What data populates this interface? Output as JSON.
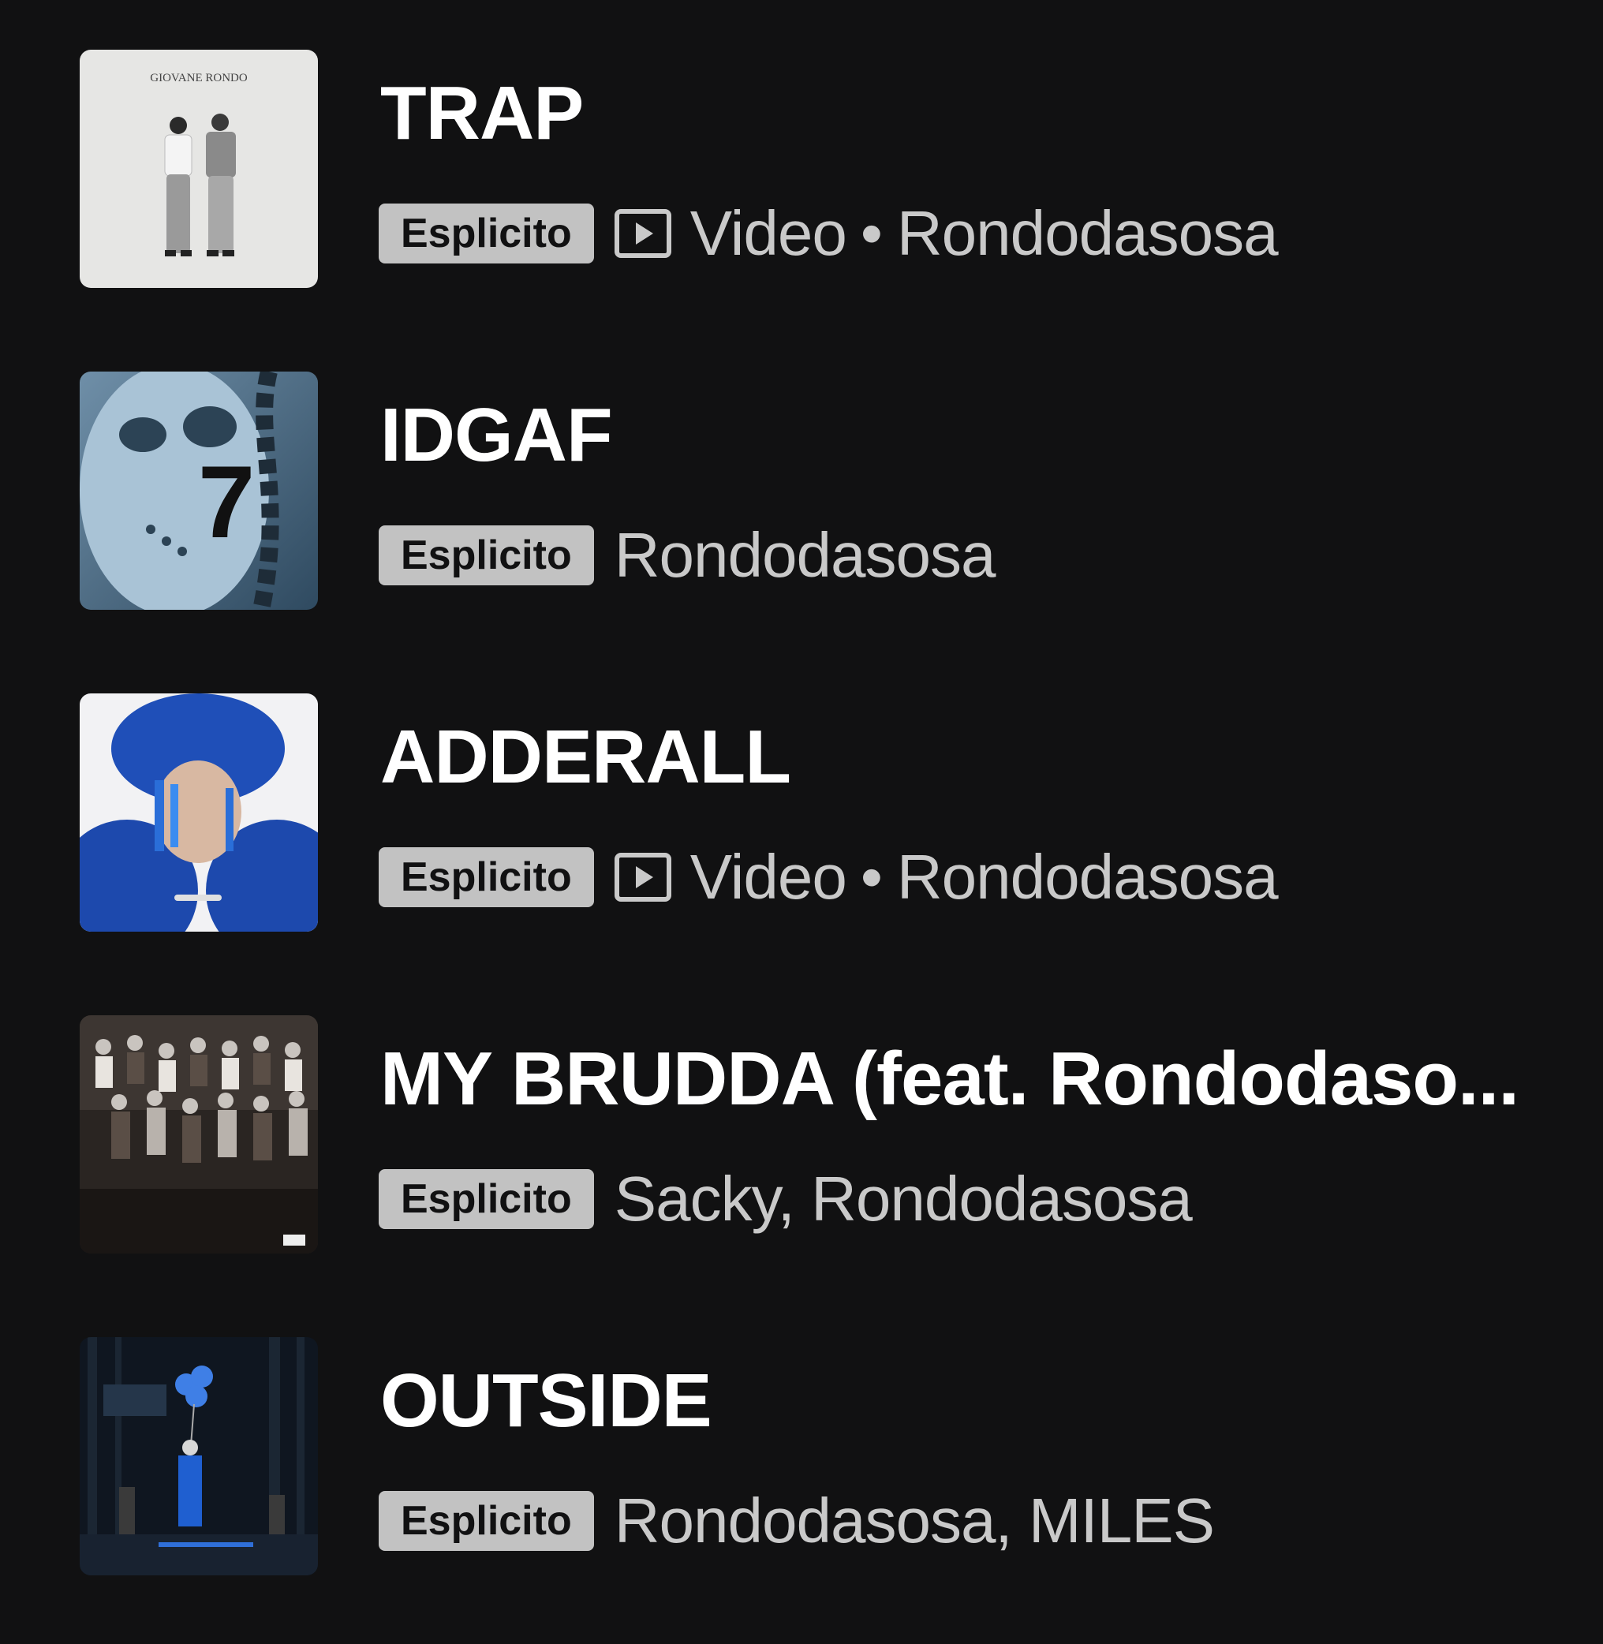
{
  "tracks": [
    {
      "title": "TRAP",
      "badge": "Esplicito",
      "has_video": true,
      "video_label": "Video",
      "separator": "•",
      "artists": "Rondodasosa",
      "art_text": "GIOVANE RONDO"
    },
    {
      "title": "IDGAF",
      "badge": "Esplicito",
      "has_video": false,
      "artists": "Rondodasosa",
      "art_text": "7"
    },
    {
      "title": "ADDERALL",
      "badge": "Esplicito",
      "has_video": true,
      "video_label": "Video",
      "separator": "•",
      "artists": "Rondodasosa"
    },
    {
      "title": "MY BRUDDA (feat. Rondodaso...",
      "badge": "Esplicito",
      "has_video": false,
      "artists": "Sacky, Rondodasosa"
    },
    {
      "title": "OUTSIDE",
      "badge": "Esplicito",
      "has_video": false,
      "artists": "Rondodasosa, MILES"
    }
  ],
  "colors": {
    "background": "#111112",
    "title": "#ffffff",
    "meta_text": "#c9c9c9",
    "badge_bg": "#c2c2c2",
    "badge_text": "#111112"
  },
  "icons": {
    "video": "play-square-icon"
  }
}
